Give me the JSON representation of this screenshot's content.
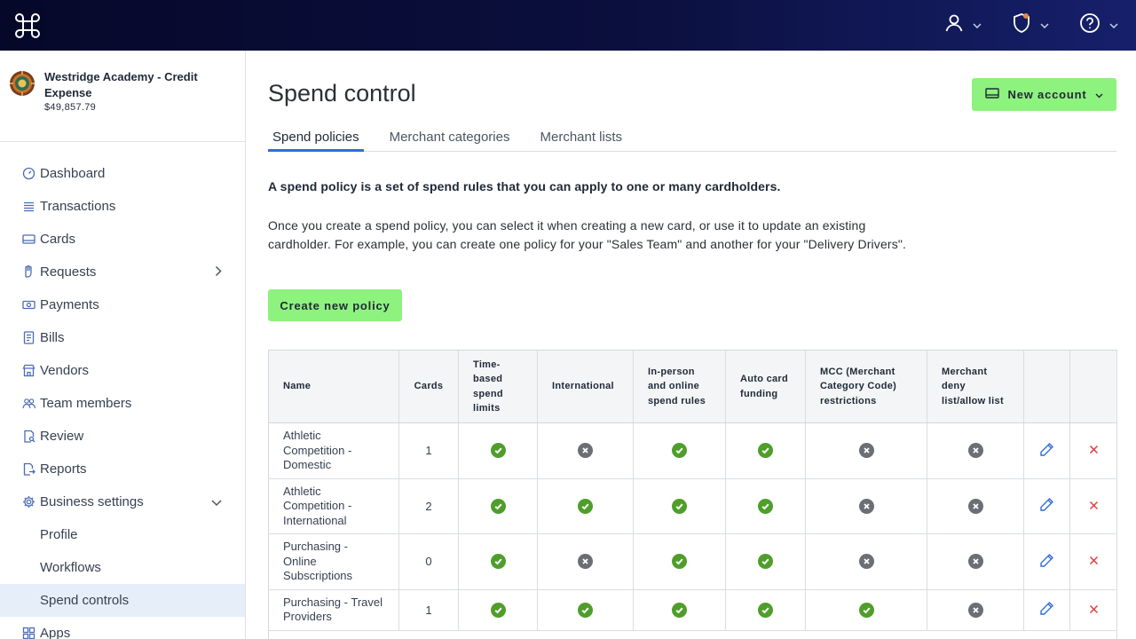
{
  "topbar": {
    "logo_icon": "command-key-logo",
    "actions": [
      {
        "icon": "user-icon"
      },
      {
        "icon": "shield-icon"
      },
      {
        "icon": "help-icon"
      }
    ],
    "chevron": "⌄"
  },
  "account": {
    "name": "Westridge Academy - Credit Expense",
    "balance": "$49,857.79"
  },
  "sidebar": {
    "items": [
      {
        "label": "Dashboard",
        "icon": "dashboard-gauge-icon"
      },
      {
        "label": "Transactions",
        "icon": "list-icon"
      },
      {
        "label": "Cards",
        "icon": "card-icon"
      },
      {
        "label": "Requests",
        "icon": "hand-icon"
      },
      {
        "label": "Payments",
        "icon": "payments-icon"
      },
      {
        "label": "Bills",
        "icon": "bill-icon"
      },
      {
        "label": "Vendors",
        "icon": "store-icon"
      },
      {
        "label": "Team members",
        "icon": "team-icon"
      },
      {
        "label": "Review",
        "icon": "review-icon"
      },
      {
        "label": "Reports",
        "icon": "reports-icon"
      },
      {
        "label": "Business settings",
        "icon": "gear-icon"
      }
    ],
    "sub_items": [
      {
        "label": "Profile"
      },
      {
        "label": "Workflows"
      },
      {
        "label": "Spend controls"
      }
    ],
    "apps": {
      "label": "Apps",
      "icon": "apps-grid-icon"
    }
  },
  "main": {
    "title": "Spend control",
    "new_account_label": "New account",
    "tabs": [
      {
        "label": "Spend policies"
      },
      {
        "label": "Merchant categories"
      },
      {
        "label": "Merchant lists"
      }
    ],
    "lead": "A spend policy is a set of spend rules that you can apply to one or many cardholders.",
    "description": "Once you create a spend policy, you can select it when creating a new card, or use it to update an existing cardholder. For example, you can create one policy for your \"Sales Team\" and another for your \"Delivery Drivers\".",
    "create_label": "Create new policy"
  },
  "table": {
    "headers": [
      "Name",
      "Cards",
      "Time-based spend limits",
      "International",
      "In-person and online spend rules",
      "Auto card funding",
      "MCC (Merchant Category Code) restrictions",
      "Merchant deny list/allow list"
    ],
    "rows": [
      {
        "name": "Athletic Competition - Domestic",
        "cards": "1",
        "flags": [
          true,
          false,
          true,
          true,
          false,
          false
        ]
      },
      {
        "name": "Athletic Competition - International",
        "cards": "2",
        "flags": [
          true,
          true,
          true,
          true,
          false,
          false
        ]
      },
      {
        "name": "Purchasing - Online Subscriptions",
        "cards": "0",
        "flags": [
          true,
          false,
          true,
          true,
          false,
          false
        ]
      },
      {
        "name": "Purchasing - Travel Providers",
        "cards": "1",
        "flags": [
          true,
          true,
          true,
          true,
          true,
          false
        ]
      }
    ],
    "colors": {
      "enabled": "#4f9e2b",
      "disabled": "#6b6f75",
      "edit": "#2f6fd6",
      "delete": "#e03e3e"
    }
  }
}
